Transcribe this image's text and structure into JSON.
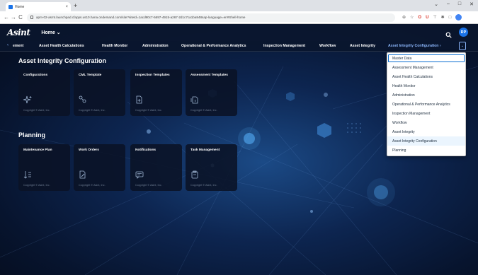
{
  "browser": {
    "tab_title": "Home",
    "tab_close": "×",
    "new_tab": "+",
    "window_controls": [
      "⌄",
      "–",
      "□",
      "✕"
    ],
    "nav": [
      "←",
      "→",
      "C"
    ],
    "url": "apm-02-asmt.launchpad.cfapps.us10.hana.ondemand.com/site?siteId=1acd90c7-5697-4915-a267-2d1c7ca1ba948sap-language=en#Shell-home",
    "extensions": [
      "⊕",
      "☆",
      "O",
      "U",
      "⊤",
      "✱",
      "□"
    ]
  },
  "shell": {
    "logo": "Asint",
    "home_label": "Home ⌄",
    "avatar_initials": "RP"
  },
  "navbar": {
    "scroll_left": "‹",
    "items": [
      "ement",
      "Asset Health Calculations",
      "Health Monitor",
      "Administration",
      "Operational & Performance Analytics",
      "Inspection Management",
      "Workflow",
      "Asset Integrity",
      "Asset Integrity Configuration ›"
    ],
    "overflow": "⌄"
  },
  "sections": [
    {
      "title": "Asset Integrity Configuration",
      "tiles": [
        {
          "title": "Configurations",
          "footer": "Copyright © Asint, Inc."
        },
        {
          "title": "CML Template",
          "footer": "Copyright © Asint, Inc."
        },
        {
          "title": "Inspection Templates",
          "footer": "Copyright © Asint, Inc."
        },
        {
          "title": "Assessment Templates",
          "footer": "Copyright © Asint, Inc."
        }
      ]
    },
    {
      "title": "Planning",
      "tiles": [
        {
          "title": "Maintenance Plan",
          "footer": "Copyright © Asint, Inc."
        },
        {
          "title": "Work Orders",
          "footer": "Copyright © Asint, Inc."
        },
        {
          "title": "Notifications",
          "footer": "Copyright © Asint, Inc."
        },
        {
          "title": "Task Management",
          "footer": "Copyright © Asint, Inc."
        }
      ]
    }
  ],
  "dropdown": {
    "items": [
      "Master Data",
      "Assessment Management",
      "Asset Health Calculations",
      "Health Monitor",
      "Administration",
      "Operational & Performance Analytics",
      "Inspection Management",
      "Workflow",
      "Asset Integrity",
      "Asset Integrity Configuration",
      "Planning"
    ]
  },
  "colors": {
    "accent": "#8ab4f8",
    "focus": "#0a6ed1",
    "tile_bg": "#0a1226"
  }
}
